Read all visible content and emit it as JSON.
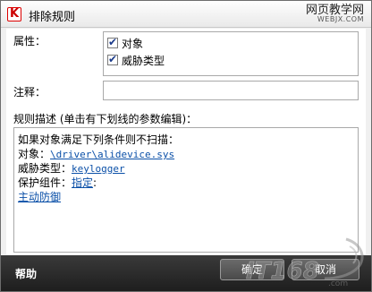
{
  "window": {
    "title": "排除规则",
    "app_icon_letter": "K",
    "watermark_top": {
      "line1": "网页教学网",
      "line2": "WEBJX.COM"
    }
  },
  "attributes": {
    "label": "属性：",
    "items": [
      {
        "label": "对象",
        "checked": true
      },
      {
        "label": "威胁类型",
        "checked": true
      }
    ]
  },
  "comment": {
    "label": "注释：",
    "value": ""
  },
  "rule_description": {
    "label": "规则描述 (单击有下划线的参数编辑)：",
    "intro": "如果对象满足下列条件则不扫描：",
    "object_label": "对象：",
    "object_value": "\\driver\\alidevice.sys",
    "threat_label": "威胁类型：",
    "threat_value": "keylogger",
    "component_label": "保护组件：",
    "component_value": "指定",
    "component_suffix": ":",
    "active_defense": "主动防御"
  },
  "footer": {
    "help": "帮助",
    "ok": "确定",
    "cancel": "取消"
  },
  "watermark_bottom": {
    "text": "IT168.com"
  }
}
